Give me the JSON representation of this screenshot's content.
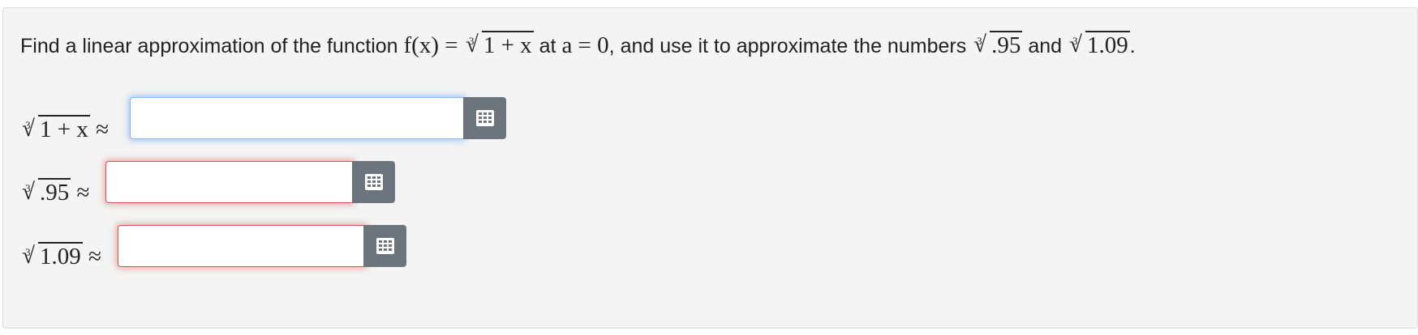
{
  "question": {
    "prefix": "Find a linear approximation of the function ",
    "func_lhs": "f(x) = ",
    "func_radicand": "1 + x",
    "mid_text": " at ",
    "point": "a = 0",
    "suffix": ", and use it to approximate the numbers ",
    "num1": ".95",
    "and_text": " and ",
    "num2": "1.09",
    "end": "."
  },
  "root_index": "3",
  "approx_symbol": "≈",
  "rows": [
    {
      "radicand": "1 + x",
      "value": "",
      "state": "focused"
    },
    {
      "radicand": ".95",
      "value": "",
      "state": "error"
    },
    {
      "radicand": "1.09",
      "value": "",
      "state": "error"
    }
  ],
  "icons": {
    "keyboard_button": "keypad-icon"
  },
  "colors": {
    "focus_border": "#86b7fe",
    "error_border": "#d9534f",
    "button_bg": "#6c757d"
  }
}
